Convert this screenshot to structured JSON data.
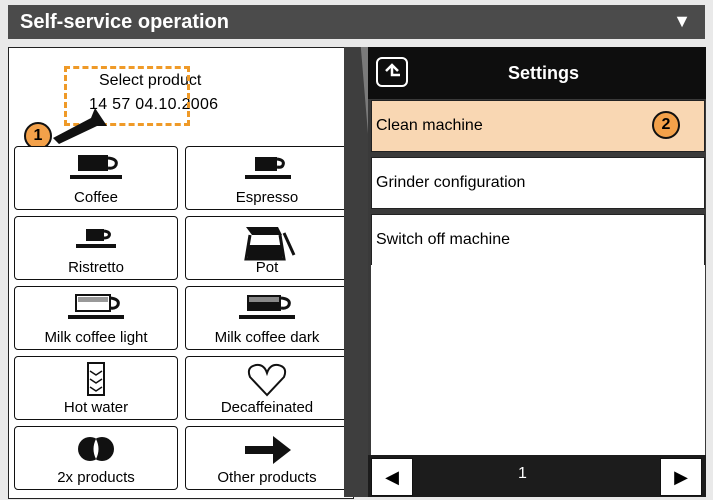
{
  "header": {
    "title": "Self-service operation",
    "arrow": "▼"
  },
  "status": {
    "prompt": "Select product",
    "datetime": "14 57   04.10.2006"
  },
  "badges": {
    "one": "1",
    "two": "2"
  },
  "products": [
    {
      "label": "Coffee",
      "icon": "coffee-cup-icon"
    },
    {
      "label": "Espresso",
      "icon": "espresso-cup-icon"
    },
    {
      "label": "Ristretto",
      "icon": "ristretto-cup-icon"
    },
    {
      "label": "Pot",
      "icon": "coffee-pot-icon"
    },
    {
      "label": "Milk coffee light",
      "icon": "milk-coffee-light-icon"
    },
    {
      "label": "Milk coffee dark",
      "icon": "milk-coffee-dark-icon"
    },
    {
      "label": "Hot water",
      "icon": "hot-water-icon"
    },
    {
      "label": "Decaffeinated",
      "icon": "heart-icon"
    },
    {
      "label": "2x products",
      "icon": "double-product-icon"
    },
    {
      "label": "Other products",
      "icon": "arrow-right-icon"
    }
  ],
  "settings": {
    "title": "Settings",
    "items": [
      "Clean machine",
      "Grinder configuration",
      "Switch off machine"
    ],
    "page": "1",
    "prev": "◀",
    "next": "▶"
  },
  "colors": {
    "accent": "#f3a14a",
    "active_row": "#f9d7b3",
    "header": "#4b4b4b"
  }
}
